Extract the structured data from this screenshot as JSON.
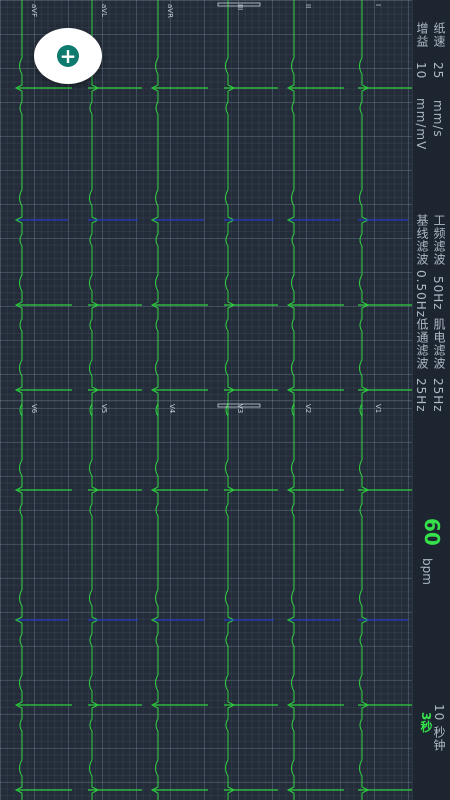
{
  "side_panel": {
    "paper_speed_label": "纸速",
    "paper_speed_value": "25",
    "paper_speed_unit": "mm/s",
    "gain_label": "增益",
    "gain_value": "10",
    "gain_unit": "mm/mV",
    "power_filter_label": "工频滤波",
    "power_filter_value": "50Hz",
    "baseline_filter_label": "基线滤波",
    "baseline_filter_value": "0.50Hz",
    "muscle_filter_label": "肌电滤波",
    "muscle_filter_value": "25Hz",
    "lowpass_filter_label": "低通滤波",
    "lowpass_filter_value": "25Hz",
    "heart_rate": "60",
    "heart_rate_unit": "bpm",
    "duration_label": "10 秒钟",
    "timer": "3秒"
  },
  "leads": {
    "top": [
      "aVF",
      "aVL",
      "aVR",
      "III",
      "II",
      "I"
    ],
    "bottom": [
      "V6",
      "V5",
      "V4",
      "V3",
      "V2",
      "V1"
    ]
  },
  "fab": {
    "icon": "plus-icon",
    "label": "+"
  },
  "colors": {
    "background": "#232c38",
    "trace": "#2fd23f",
    "qrs": "#2638c8",
    "accent": "#35e04a",
    "fab_icon": "#0f7b6e"
  }
}
